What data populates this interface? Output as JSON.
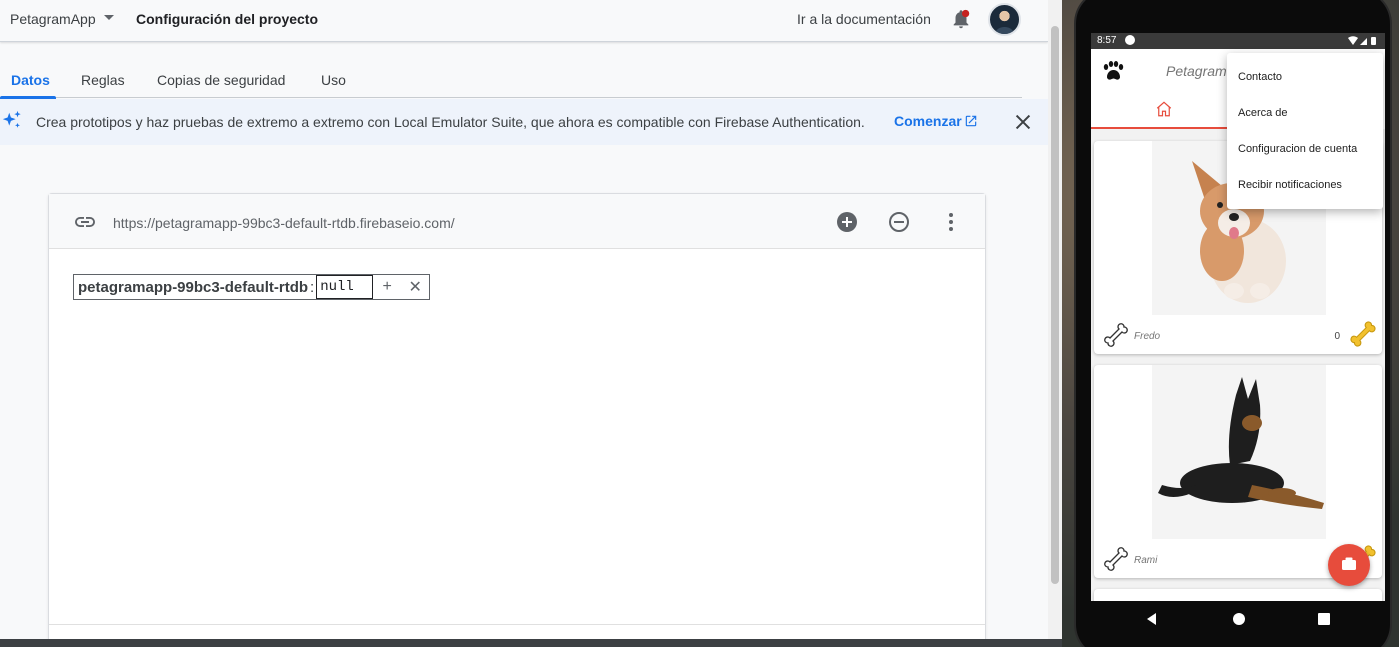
{
  "console": {
    "project_name": "PetagramApp",
    "page_title": "Configuración del proyecto",
    "docs_link": "Ir a la documentación",
    "tabs": [
      {
        "label": "Datos"
      },
      {
        "label": "Reglas"
      },
      {
        "label": "Copias de seguridad"
      },
      {
        "label": "Uso"
      }
    ],
    "active_tab": "Datos",
    "banner": {
      "text": "Crea prototipos y haz pruebas de extremo a extremo con Local Emulator Suite, que ahora es compatible con Firebase Authentication.",
      "cta": "Comenzar"
    },
    "database": {
      "url": "https://petagramapp-99bc3-default-rtdb.firebaseio.com/",
      "root_key": "petagramapp-99bc3-default-rtdb",
      "separator": ":",
      "root_value": "null"
    },
    "icons": [
      "dropdown-caret-icon",
      "notification-bell-icon",
      "sparkle-icon",
      "external-link-icon",
      "close-icon",
      "link-icon",
      "add-circle-icon",
      "remove-circle-icon",
      "more-vert-icon",
      "plus-icon",
      "x-icon"
    ],
    "colors": {
      "accent": "#1a73e8",
      "bell": "#c5221f"
    }
  },
  "phone": {
    "status_time": "8:57",
    "app_title": "Petagram",
    "menu": [
      "Contacto",
      "Acerca de",
      "Configuracion de cuenta",
      "Recibir notificaciones"
    ],
    "pets": [
      {
        "name": "Fredo",
        "likes": "0"
      },
      {
        "name": "Rami",
        "likes": ""
      }
    ],
    "colors": {
      "accent": "#e74c3c",
      "bone": "#f2c12e"
    }
  }
}
